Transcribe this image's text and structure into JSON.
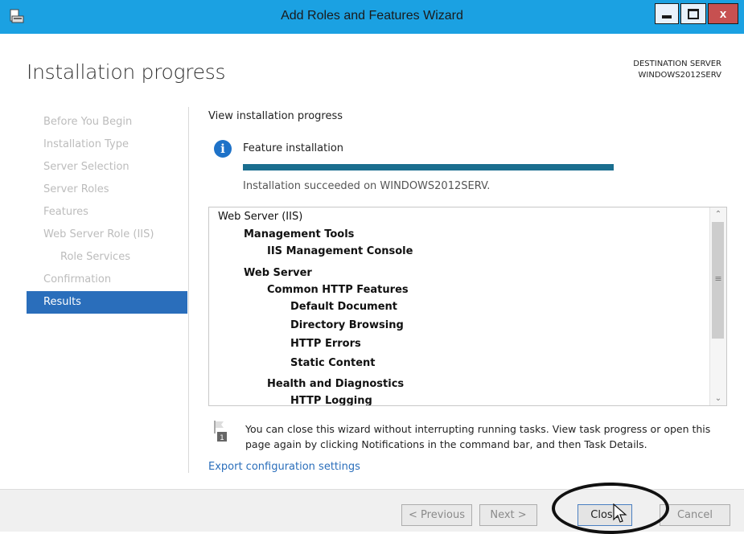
{
  "window": {
    "title": "Add Roles and Features Wizard",
    "controls": {
      "minimize": "minimize-icon",
      "maximize": "maximize-icon",
      "close": "x"
    }
  },
  "header": {
    "page_title": "Installation progress",
    "destination_label": "DESTINATION SERVER",
    "destination_server": "WINDOWS2012SERV"
  },
  "sidebar": {
    "items": [
      {
        "label": "Before You Begin",
        "state": "disabled"
      },
      {
        "label": "Installation Type",
        "state": "disabled"
      },
      {
        "label": "Server Selection",
        "state": "disabled"
      },
      {
        "label": "Server Roles",
        "state": "disabled"
      },
      {
        "label": "Features",
        "state": "disabled"
      },
      {
        "label": "Web Server Role (IIS)",
        "state": "disabled"
      },
      {
        "label": "Role Services",
        "state": "disabled",
        "indent": 1
      },
      {
        "label": "Confirmation",
        "state": "disabled"
      },
      {
        "label": "Results",
        "state": "active"
      }
    ]
  },
  "main": {
    "section_label": "View installation progress",
    "feature_label": "Feature installation",
    "progress": 1.0,
    "status_text": "Installation succeeded on WINDOWS2012SERV.",
    "results": [
      {
        "label": "Web Server (IIS)",
        "indent": 0
      },
      {
        "label": "Management Tools",
        "indent": 1
      },
      {
        "label": "IIS Management Console",
        "indent": 2
      },
      {
        "label": "Web Server",
        "indent": 1
      },
      {
        "label": "Common HTTP Features",
        "indent": 2
      },
      {
        "label": "Default Document",
        "indent": 3
      },
      {
        "label": "Directory Browsing",
        "indent": 3
      },
      {
        "label": "HTTP Errors",
        "indent": 3
      },
      {
        "label": "Static Content",
        "indent": 3
      },
      {
        "label": "Health and Diagnostics",
        "indent": 2
      },
      {
        "label": "HTTP Logging",
        "indent": 3
      }
    ],
    "note_badge": "1",
    "note_text": "You can close this wizard without interrupting running tasks. View task progress or open this page again by clicking Notifications in the command bar, and then Task Details.",
    "export_link": "Export configuration settings"
  },
  "footer": {
    "previous": "< Previous",
    "next": "Next >",
    "close": "Close",
    "cancel": "Cancel"
  },
  "colors": {
    "titlebar": "#1ba1e2",
    "active_nav": "#2a6ebb",
    "progress": "#1a6e8f",
    "link": "#2a6ebb"
  }
}
